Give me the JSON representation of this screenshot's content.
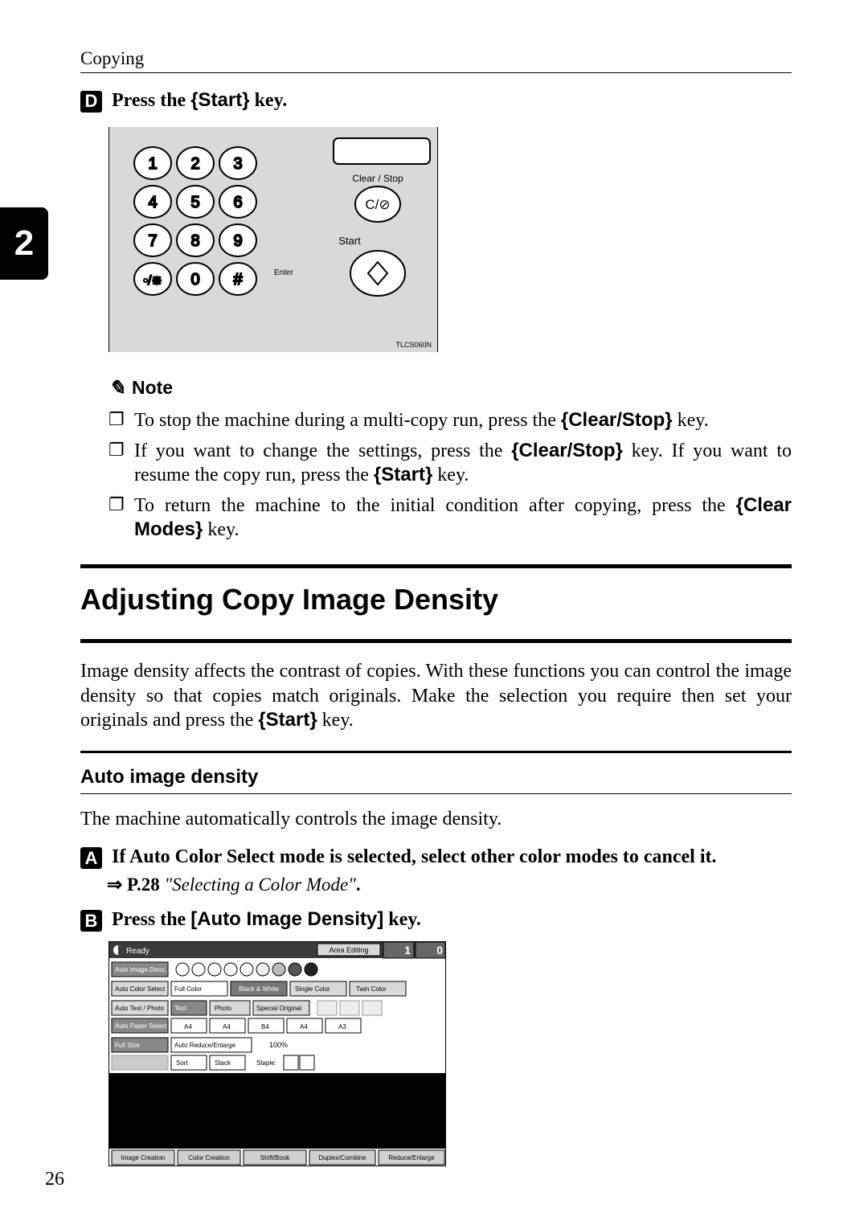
{
  "header": {
    "chapter_title": "Copying"
  },
  "chapter_tab": "2",
  "step4": {
    "num": "D",
    "prefix": "Press the ",
    "key": "Start",
    "suffix": " key."
  },
  "keypad": {
    "keys": {
      "k1": "1",
      "k2": "2",
      "k3": "3",
      "k4": "4",
      "k5": "5",
      "k6": "6",
      "k7": "7",
      "k8": "8",
      "k9": "9",
      "star": "•/⋇",
      "k0": "0",
      "hash": "#"
    },
    "labels": {
      "clear_stop": "Clear / Stop",
      "start": "Start",
      "enter": "Enter"
    },
    "start_glyph": "C/⊘",
    "fig_code": "TLCS060N"
  },
  "note": {
    "icon_label": "pencil-icon",
    "heading": "Note"
  },
  "bullets": {
    "b1_a": "To stop the machine during a multi-copy run, press the ",
    "b1_key": "Clear/Stop",
    "b1_b": " key.",
    "b2_a": "If you want to change the settings, press the ",
    "b2_key1": "Clear/Stop",
    "b2_b": " key. If you want to resume the copy run, press the ",
    "b2_key2": "Start",
    "b2_c": " key.",
    "b3_a": "To return the machine to the initial condition after copying, press the ",
    "b3_key": "Clear Modes",
    "b3_b": " key."
  },
  "section": {
    "title": "Adjusting Copy Image Density",
    "intro_a": "Image density affects the contrast of copies. With these functions you can control the image density so that copies match originals. Make the selection you require then set your originals and press the ",
    "intro_key": "Start",
    "intro_b": " key."
  },
  "subsection": {
    "title": "Auto image density",
    "body": "The machine automatically controls the image density."
  },
  "step1b": {
    "num": "A",
    "text_a": "If Auto Color Select mode is selected, select other color modes to cancel it.",
    "arrow": "⇒",
    "ref_page": " P.28 ",
    "ref_title": "\"Selecting a Color Mode\"",
    "ref_end": "."
  },
  "step2b": {
    "num": "B",
    "prefix": "Press the ",
    "key": "[Auto Image Density]",
    "suffix": " key."
  },
  "panel": {
    "ready": "Ready",
    "area_editing": "Area Editing",
    "qty": "1",
    "copy": "0",
    "rows": {
      "auto_image_dens": "Auto Image Dens.",
      "auto_color_select": "Auto Color Select",
      "full_color": "Full Color",
      "black_white": "Black & White",
      "single_color": "Single Color",
      "twin_color": "Twin Color",
      "auto_text_photo": "Auto Text / Photo",
      "text": "Text",
      "photo": "Photo",
      "special_original": "Special Original",
      "auto_paper_select": "Auto Paper Select",
      "p1": "A4",
      "p2": "A4",
      "p3": "B4",
      "p4": "A4",
      "p5": "A3",
      "full_size": "Full Size",
      "auto_reduce_enlarge": "Auto Reduce/Enlarge",
      "ratio": "100%",
      "sort": "Sort",
      "stack": "Stack",
      "staple": "Staple:"
    },
    "tabs": {
      "image_creation": "Image Creation",
      "color_creation": "Color Creation",
      "shift_book": "Shift/Book",
      "duplex_combine": "Duplex/Combine",
      "reduce_enlarge": "Reduce/Enlarge"
    }
  },
  "page_number": "26"
}
